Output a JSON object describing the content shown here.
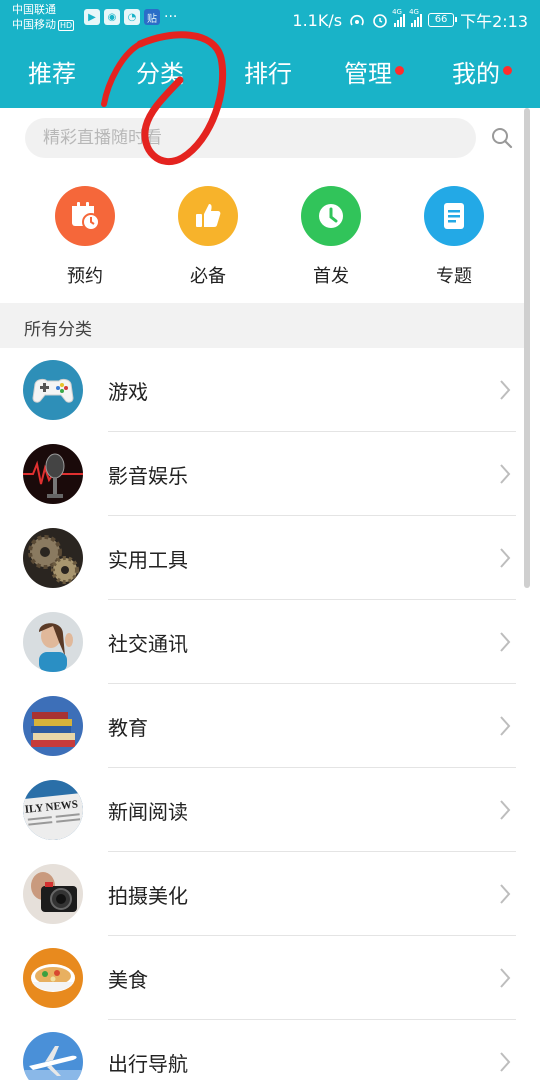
{
  "status_bar": {
    "carrier_1": "中国联通",
    "carrier_2": "中国移动",
    "hd_badge": "HD",
    "notif_badge": "贴",
    "more": "···",
    "speed": "1.1K/s",
    "net_tag_1": "4G",
    "net_tag_2": "4G",
    "battery": "66",
    "time": "下午2:13"
  },
  "tabs": [
    {
      "label": "推荐",
      "dot": false
    },
    {
      "label": "分类",
      "dot": false,
      "active": true
    },
    {
      "label": "排行",
      "dot": false
    },
    {
      "label": "管理",
      "dot": true
    },
    {
      "label": "我的",
      "dot": true
    }
  ],
  "search": {
    "placeholder": "精彩直播随时看"
  },
  "quick_entries": [
    {
      "label": "预约",
      "icon": "calendar-clock-icon",
      "color": "#f5673a"
    },
    {
      "label": "必备",
      "icon": "thumbs-up-icon",
      "color": "#f7b32b"
    },
    {
      "label": "首发",
      "icon": "clock-icon",
      "color": "#31c45a"
    },
    {
      "label": "专题",
      "icon": "document-icon",
      "color": "#23a9e6"
    }
  ],
  "section_title": "所有分类",
  "categories": [
    {
      "label": "游戏",
      "icon": "gamepad-icon"
    },
    {
      "label": "影音娱乐",
      "icon": "microphone-icon"
    },
    {
      "label": "实用工具",
      "icon": "gears-icon"
    },
    {
      "label": "社交通讯",
      "icon": "person-icon"
    },
    {
      "label": "教育",
      "icon": "books-icon"
    },
    {
      "label": "新闻阅读",
      "icon": "newspaper-icon"
    },
    {
      "label": "拍摄美化",
      "icon": "camera-icon"
    },
    {
      "label": "美食",
      "icon": "food-bowl-icon"
    },
    {
      "label": "出行导航",
      "icon": "airplane-icon"
    }
  ],
  "newspaper_text": "ILY NEWS",
  "colors": {
    "header": "#19b3c8",
    "badge_dot": "#ff2d2d",
    "annotation": "#e4231f"
  }
}
